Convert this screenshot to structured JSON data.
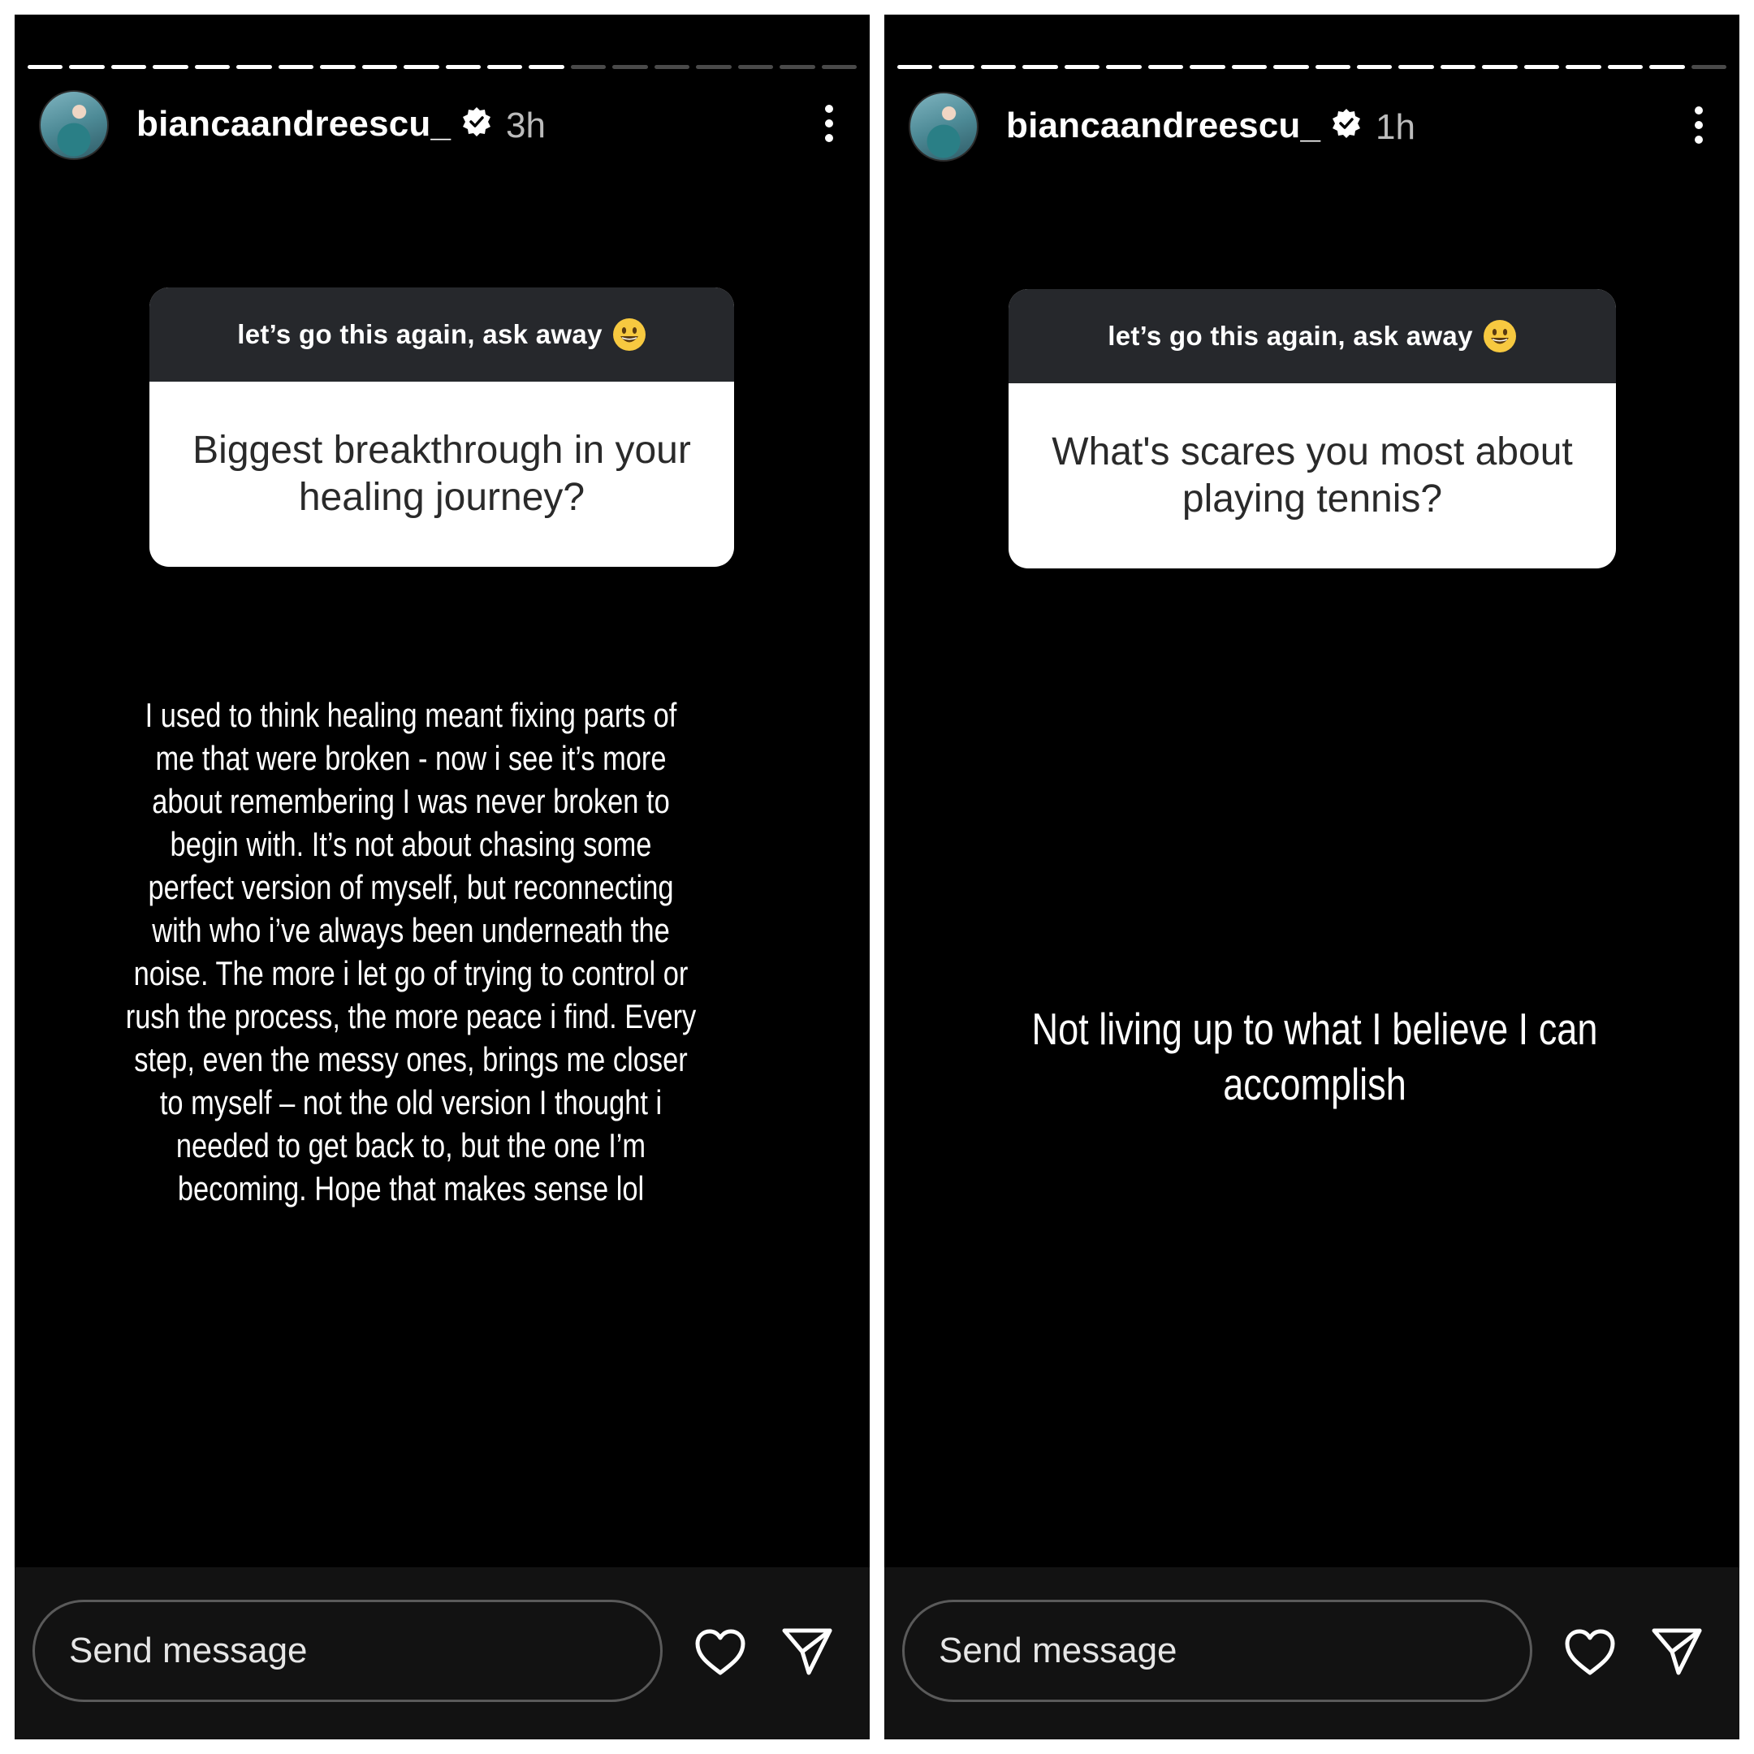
{
  "stories": [
    {
      "username": "biancaandreescu_",
      "time": "3h",
      "progress": {
        "segments": 20,
        "seen": 13
      },
      "question_header": "let’s go this again, ask away",
      "question": "Biggest breakthrough in your healing journey?",
      "answer": "I used to think healing meant fixing parts of me that were broken - now i see it’s more about remembering I was never broken to begin with. It’s not about chasing some perfect version of myself, but reconnecting with who i’ve always been underneath the noise. The more i let go of trying to control or rush the process, the more peace i find. Every step, even the messy ones, brings me closer to myself – not the old version I thought i needed to get back to, but the one I’m becoming. Hope that makes sense lol",
      "message_placeholder": "Send message"
    },
    {
      "username": "biancaandreescu_",
      "time": "1h",
      "progress": {
        "segments": 20,
        "seen": 19
      },
      "question_header": "let’s go this again, ask away",
      "question": "What's scares you most about playing tennis?",
      "answer": "Not living up to what I believe I can accomplish",
      "message_placeholder": "Send message"
    }
  ],
  "icons": [
    "verified-badge-icon",
    "more-options-icon",
    "smiley-emoji-icon",
    "heart-icon",
    "send-icon"
  ]
}
